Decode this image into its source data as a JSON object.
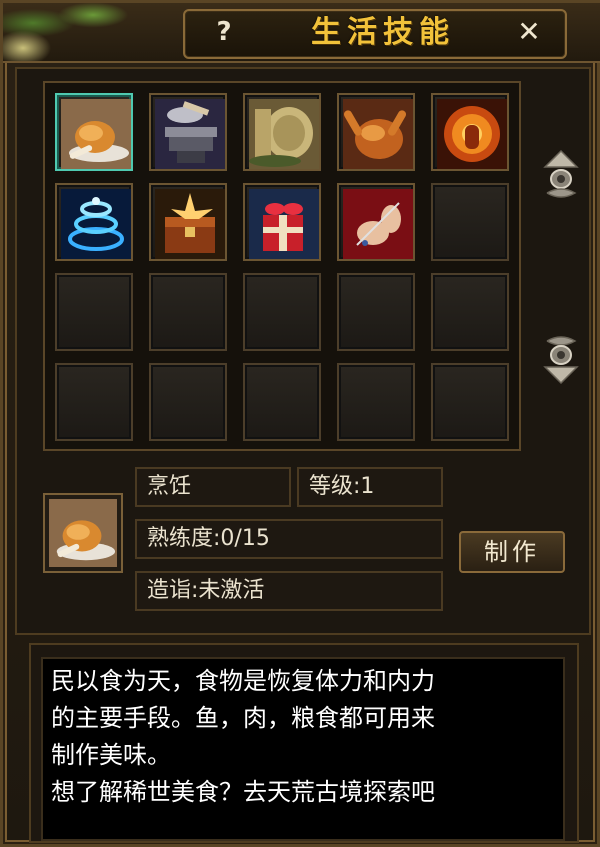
{
  "window": {
    "title": "生活技能",
    "help_glyph": "?",
    "close_glyph": "✕"
  },
  "skills": [
    {
      "name": "roast-chicken-icon",
      "filled": true,
      "selected": true
    },
    {
      "name": "anvil-hammer-icon",
      "filled": true
    },
    {
      "name": "grindstone-icon",
      "filled": true
    },
    {
      "name": "roast-duck-icon",
      "filled": true
    },
    {
      "name": "fire-aura-icon",
      "filled": true
    },
    {
      "name": "blue-vortex-icon",
      "filled": true
    },
    {
      "name": "treasure-chest-icon",
      "filled": true
    },
    {
      "name": "gift-box-icon",
      "filled": true
    },
    {
      "name": "needlework-icon",
      "filled": true
    },
    {
      "name": "empty-slot",
      "filled": false
    },
    {
      "name": "empty-slot",
      "filled": false
    },
    {
      "name": "empty-slot",
      "filled": false
    },
    {
      "name": "empty-slot",
      "filled": false
    },
    {
      "name": "empty-slot",
      "filled": false
    },
    {
      "name": "empty-slot",
      "filled": false
    },
    {
      "name": "empty-slot",
      "filled": false
    },
    {
      "name": "empty-slot",
      "filled": false
    },
    {
      "name": "empty-slot",
      "filled": false
    },
    {
      "name": "empty-slot",
      "filled": false
    },
    {
      "name": "empty-slot",
      "filled": false
    }
  ],
  "detail": {
    "skill_name": "烹饪",
    "level": "等级:1",
    "proficiency": "熟练度:0/15",
    "mastery": "造诣:未激活",
    "make_button": "制作"
  },
  "description": {
    "lines": [
      "民以食为天，食物是恢复体力和内力",
      "的主要手段。鱼，肉，粮食都可用来",
      "制作美味。",
      "想了解稀世美食？去天荒古境探索吧"
    ]
  },
  "colors": {
    "title_gold": "#f2c23a",
    "selected_border": "#4fc9b0",
    "frame_bronze": "#8a6a38"
  }
}
